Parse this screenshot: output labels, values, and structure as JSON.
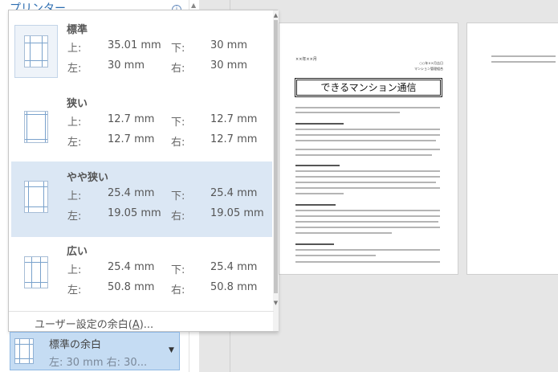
{
  "left_panel": {
    "section_label": "プリンター",
    "info_icon": "info-icon"
  },
  "document": {
    "date_text": "××年××月",
    "sender_line1": "○○年××月吉日",
    "sender_line2": "マンション管理組合",
    "title": "できるマンション通信"
  },
  "margins": {
    "options": [
      {
        "name": "標準",
        "top_label": "上:",
        "top": "35.01 mm",
        "bottom_label": "下:",
        "bottom": "30 mm",
        "left_label": "左:",
        "left": "30 mm",
        "right_label": "右:",
        "right": "30 mm",
        "selected": false
      },
      {
        "name": "狭い",
        "top_label": "上:",
        "top": "12.7 mm",
        "bottom_label": "下:",
        "bottom": "12.7 mm",
        "left_label": "左:",
        "left": "12.7 mm",
        "right_label": "右:",
        "right": "12.7 mm",
        "selected": false
      },
      {
        "name": "やや狭い",
        "top_label": "上:",
        "top": "25.4 mm",
        "bottom_label": "下:",
        "bottom": "25.4 mm",
        "left_label": "左:",
        "left": "19.05 mm",
        "right_label": "右:",
        "right": "19.05 mm",
        "selected": true
      },
      {
        "name": "広い",
        "top_label": "上:",
        "top": "25.4 mm",
        "bottom_label": "下:",
        "bottom": "25.4 mm",
        "left_label": "左:",
        "left": "50.8 mm",
        "right_label": "右:",
        "right": "50.8 mm",
        "selected": false
      }
    ],
    "custom_label_prefix": "ユーザー設定の余白(",
    "custom_label_key": "A",
    "custom_label_suffix": ")...",
    "current": {
      "title": "標準の余白",
      "detail": "左: 30 mm   右: 30..."
    }
  },
  "colors": {
    "selected_bg": "#dbe7f4",
    "current_bg": "#c5dcf3",
    "accent": "#2b6cb0"
  }
}
